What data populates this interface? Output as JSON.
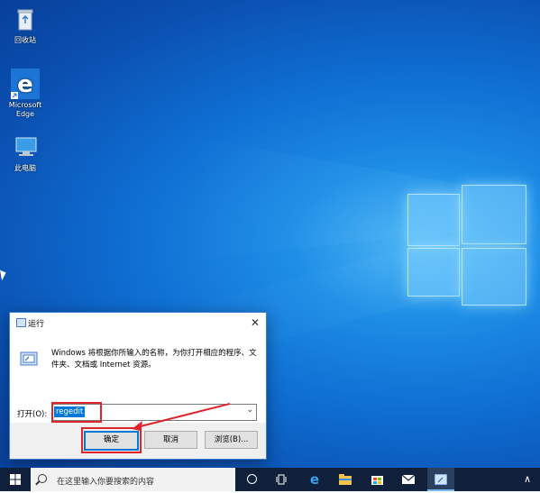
{
  "desktop": {
    "icons": [
      {
        "label": "回收站"
      },
      {
        "label": "Microsoft Edge"
      },
      {
        "label": "此电脑"
      }
    ]
  },
  "run_dialog": {
    "title": "运行",
    "close_glyph": "✕",
    "description": "Windows 将根据你所输入的名称，为你打开相应的程序、文件夹、文档或 Internet 资源。",
    "open_label": "打开(O):",
    "input_value": "regedit",
    "dropdown_glyph": "⌄",
    "buttons": {
      "ok": "确定",
      "cancel": "取消",
      "browse": "浏览(B)..."
    },
    "highlight_color": "#e0242b"
  },
  "taskbar": {
    "search_placeholder": "在这里输入你要搜索的内容",
    "tray_chevron": "∧"
  },
  "colors": {
    "accent": "#0078d7",
    "desktop_blue": "#0f6fd3"
  }
}
